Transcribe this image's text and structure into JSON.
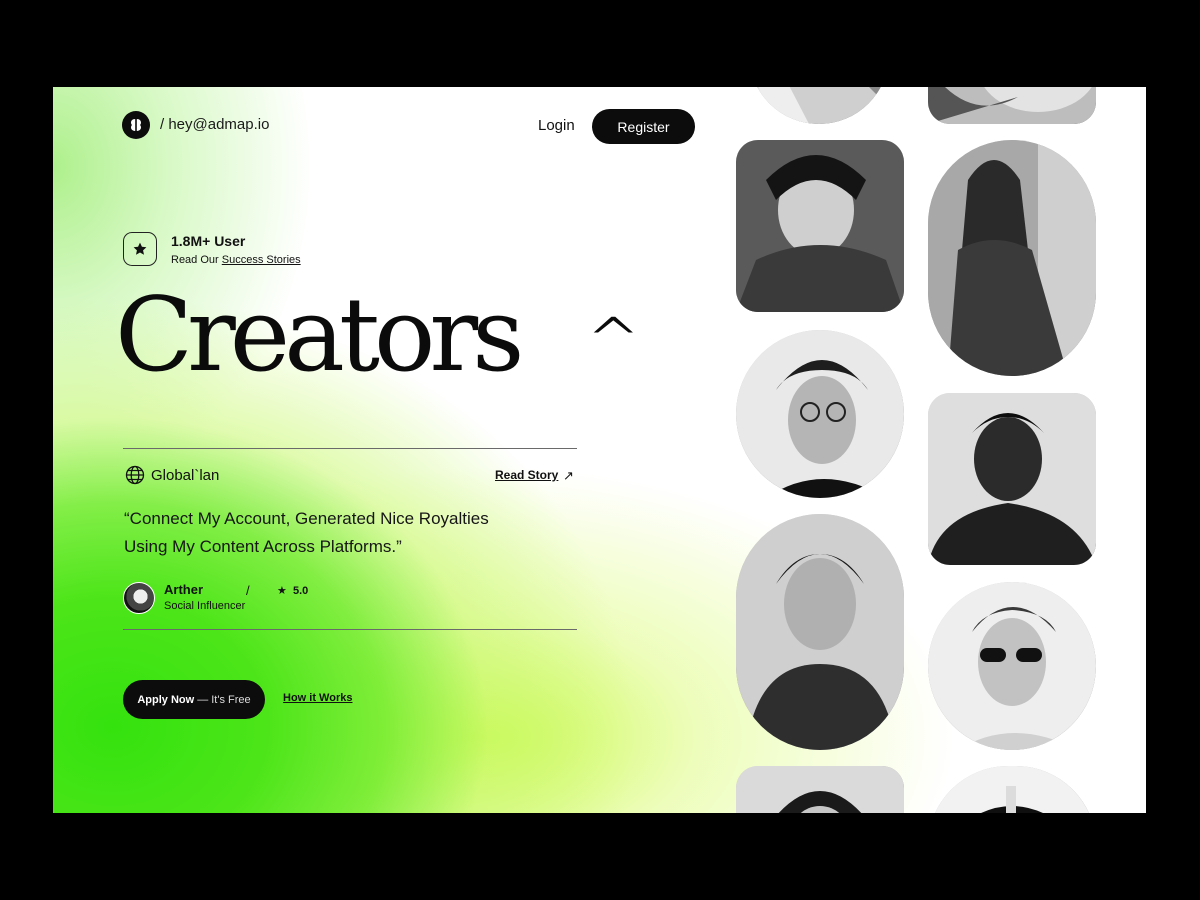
{
  "header": {
    "email": "/ hey@admap.io",
    "login_label": "Login",
    "register_label": "Register"
  },
  "stats": {
    "user_count": "1.8M+ User",
    "read_prefix": "Read Our",
    "success_link": "Success Stories",
    "icon": "star-icon"
  },
  "hero": {
    "headline": "Creators",
    "caret": "^"
  },
  "testimonial": {
    "company": "Global`lan",
    "company_icon": "globe-icon",
    "read_story_label": "Read Story",
    "arrow_icon": "arrow-up-right-icon",
    "arrow": "↗",
    "quote_line1": "“Connect My Account, Generated Nice Royalties",
    "quote_line2": "Using My Content Across Platforms.”",
    "author_name": "Arther",
    "author_role": "Social Influencer",
    "separator": "/",
    "rating": "5.0",
    "rating_star": "★"
  },
  "cta": {
    "apply_bold": "Apply Now",
    "apply_rest": "— It's Free",
    "how_label": "How it Works"
  },
  "colors": {
    "accent_green": "#34e20e",
    "accent_lime": "#c8fa46",
    "button_dark": "#0c0c0c"
  }
}
